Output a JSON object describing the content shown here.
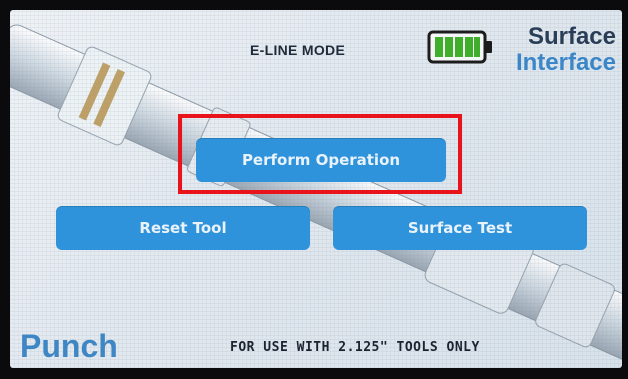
{
  "header": {
    "mode_title": "E-LINE MODE",
    "brand_line1": "Surface",
    "brand_line2": "Interface"
  },
  "battery": {
    "level": 1.0,
    "fill_color": "#3fae2a",
    "icon": "battery-icon"
  },
  "buttons": {
    "perform_operation": "Perform Operation",
    "reset_tool": "Reset Tool",
    "surface_test": "Surface Test"
  },
  "footer": {
    "mode_label": "Punch",
    "notice": "FOR USE WITH 2.125\" TOOLS ONLY"
  },
  "colors": {
    "button_bg": "#2f93dc",
    "highlight": "#e8131b",
    "brand_blue": "#3a86c8",
    "brand_dark": "#2a3d57"
  }
}
